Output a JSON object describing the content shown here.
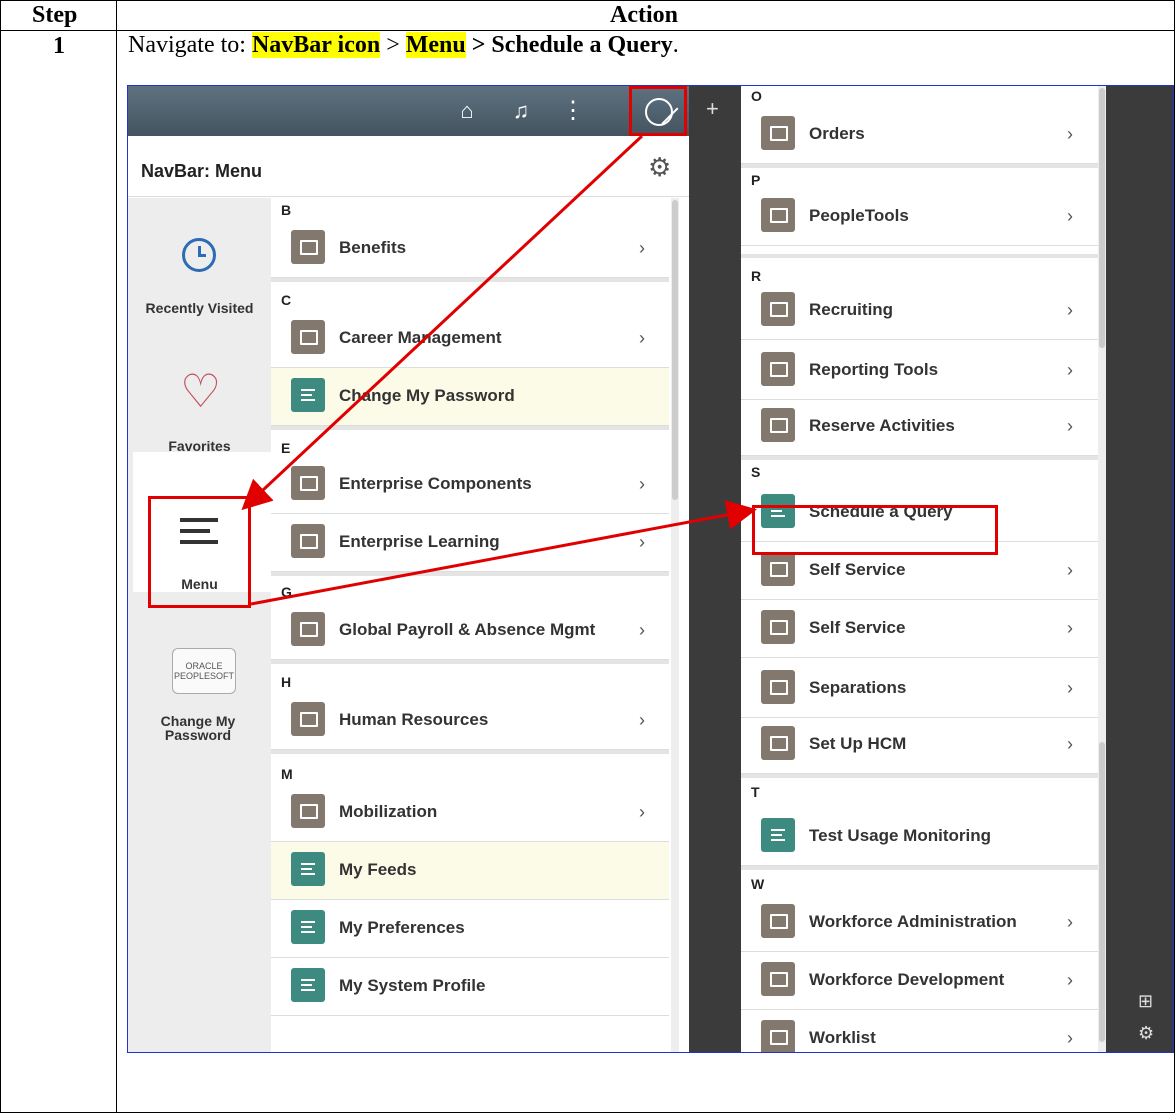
{
  "table": {
    "col_step": "Step",
    "col_action": "Action",
    "step_number": "1"
  },
  "instruction": {
    "prefix": "Navigate to: ",
    "part1": "NavBar icon",
    "sep1": " > ",
    "part2": "Menu",
    "sep2": " > Schedule a Query",
    "suffix": "."
  },
  "colors": {
    "highlight": "#ffff00",
    "callout": "#e00000",
    "folder": "#82786e",
    "component": "#3d8b80"
  },
  "navbar": {
    "title": "NavBar: Menu",
    "icons": [
      "home-icon",
      "bell-icon",
      "more-icon",
      "navbar-compass-icon",
      "plus-icon",
      "gear-icon"
    ]
  },
  "sidebar": {
    "recent": "Recently Visited",
    "favorites": "Favorites",
    "menu": "Menu",
    "oracle_line1": "ORACLE",
    "oracle_line2": "PEOPLESOFT",
    "change_pw": "Change My Password"
  },
  "left_list": {
    "letters": [
      "B",
      "C",
      "E",
      "G",
      "H",
      "M"
    ],
    "items": [
      {
        "label": "Benefits",
        "kind": "folder"
      },
      {
        "label": "Career Management",
        "kind": "folder"
      },
      {
        "label": "Change My Password",
        "kind": "component"
      },
      {
        "label": "Enterprise Components",
        "kind": "folder"
      },
      {
        "label": "Enterprise Learning",
        "kind": "folder"
      },
      {
        "label": "Global Payroll & Absence Mgmt",
        "kind": "folder"
      },
      {
        "label": "Human Resources",
        "kind": "folder"
      },
      {
        "label": "Mobilization",
        "kind": "folder"
      },
      {
        "label": "My Feeds",
        "kind": "component"
      },
      {
        "label": "My Preferences",
        "kind": "component"
      },
      {
        "label": "My System Profile",
        "kind": "component"
      }
    ]
  },
  "right_list": {
    "letters": [
      "O",
      "P",
      "R",
      "S",
      "T",
      "W"
    ],
    "items": [
      {
        "label": "Orders",
        "kind": "folder"
      },
      {
        "label": "PeopleTools",
        "kind": "folder"
      },
      {
        "label": "Recruiting",
        "kind": "folder"
      },
      {
        "label": "Reporting Tools",
        "kind": "folder"
      },
      {
        "label": "Reserve Activities",
        "kind": "folder"
      },
      {
        "label": "Schedule a Query",
        "kind": "component"
      },
      {
        "label": "Self Service",
        "kind": "folder"
      },
      {
        "label": "Self Service",
        "kind": "folder"
      },
      {
        "label": "Separations",
        "kind": "folder"
      },
      {
        "label": "Set Up HCM",
        "kind": "folder"
      },
      {
        "label": "Test Usage Monitoring",
        "kind": "component"
      },
      {
        "label": "Workforce Administration",
        "kind": "folder"
      },
      {
        "label": "Workforce Development",
        "kind": "folder"
      },
      {
        "label": "Worklist",
        "kind": "folder"
      }
    ]
  }
}
